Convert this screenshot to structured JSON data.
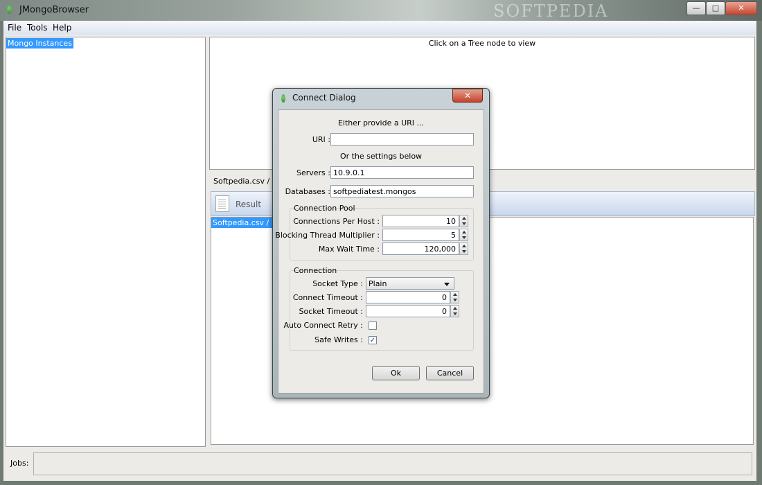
{
  "window": {
    "title": "JMongoBrowser",
    "watermark": "SOFTPEDIA",
    "minimize": "—",
    "maximize": "□",
    "close": "✕"
  },
  "menu": [
    "File",
    "Tools",
    "Help"
  ],
  "tree": {
    "root": "Mongo Instances"
  },
  "top_panel": {
    "hint": "Click on a Tree node to view"
  },
  "lower": {
    "tab": "Softpedia.csv / Im",
    "toolbar_label": "Result",
    "result_item": "Softpedia.csv / Im"
  },
  "jobs": {
    "label": "Jobs:"
  },
  "dialog": {
    "title": "Connect Dialog",
    "close": "✕",
    "either_text": "Either provide a URI ...",
    "uri_label": "URI :",
    "uri_value": "",
    "or_text": "Or the settings below",
    "servers_label": "Servers :",
    "servers_value": "10.9.0.1",
    "databases_label": "Databases :",
    "databases_value": "softpediatest.mongos",
    "pool": {
      "title": "Connection Pool",
      "per_host_label": "Connections Per Host :",
      "per_host_value": "10",
      "multiplier_label": "Blocking Thread Multiplier :",
      "multiplier_value": "5",
      "wait_label": "Max Wait Time :",
      "wait_value": "120,000"
    },
    "connection": {
      "title": "Connection",
      "socket_type_label": "Socket Type :",
      "socket_type_value": "Plain",
      "connect_timeout_label": "Connect Timeout :",
      "connect_timeout_value": "0",
      "socket_timeout_label": "Socket Timeout :",
      "socket_timeout_value": "0",
      "auto_retry_label": "Auto Connect Retry :",
      "auto_retry_checked": false,
      "safe_writes_label": "Safe Writes :",
      "safe_writes_checked": true,
      "check_mark": "✓"
    },
    "ok": "Ok",
    "cancel": "Cancel"
  }
}
